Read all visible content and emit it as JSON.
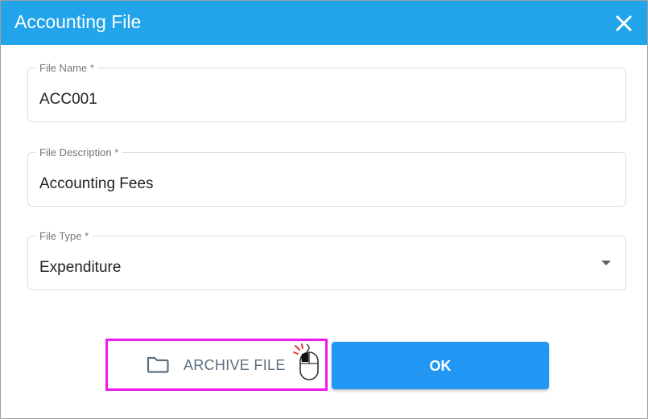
{
  "dialog": {
    "title": "Accounting File",
    "close_icon": "close-icon",
    "header_color": "#22a4ea"
  },
  "fields": {
    "file_name": {
      "label": "File Name *",
      "value": "ACC001"
    },
    "file_description": {
      "label": "File Description *",
      "value": "Accounting Fees"
    },
    "file_type": {
      "label": "File Type *",
      "value": "Expenditure"
    }
  },
  "actions": {
    "archive_label": "ARCHIVE FILE",
    "archive_icon": "folder-icon",
    "ok_label": "OK",
    "ok_color": "#2196f3",
    "highlight_color": "#ef19ef"
  }
}
